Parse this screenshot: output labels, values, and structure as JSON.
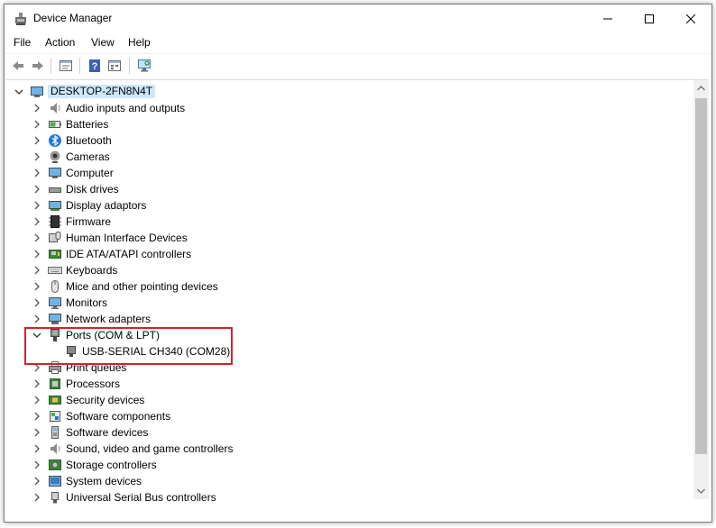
{
  "window": {
    "title": "Device Manager",
    "menu": [
      "File",
      "Action",
      "View",
      "Help"
    ]
  },
  "toolbar": {
    "buttons": [
      "back-icon",
      "forward-icon",
      "properties-icon",
      "help-icon",
      "show-hidden-icon",
      "scan-hardware-icon"
    ]
  },
  "tree": {
    "root": "DESKTOP-2FN8N4T",
    "categories": [
      {
        "label": "Audio inputs and outputs",
        "icon": "speaker-icon",
        "expanded": false
      },
      {
        "label": "Batteries",
        "icon": "battery-icon",
        "expanded": false
      },
      {
        "label": "Bluetooth",
        "icon": "bluetooth-icon",
        "expanded": false
      },
      {
        "label": "Cameras",
        "icon": "camera-icon",
        "expanded": false
      },
      {
        "label": "Computer",
        "icon": "computer-icon",
        "expanded": false
      },
      {
        "label": "Disk drives",
        "icon": "disk-drive-icon",
        "expanded": false
      },
      {
        "label": "Display adaptors",
        "icon": "display-adapter-icon",
        "expanded": false
      },
      {
        "label": "Firmware",
        "icon": "firmware-icon",
        "expanded": false
      },
      {
        "label": "Human Interface Devices",
        "icon": "hid-icon",
        "expanded": false
      },
      {
        "label": "IDE ATA/ATAPI controllers",
        "icon": "ide-controller-icon",
        "expanded": false
      },
      {
        "label": "Keyboards",
        "icon": "keyboard-icon",
        "expanded": false
      },
      {
        "label": "Mice and other pointing devices",
        "icon": "mouse-icon",
        "expanded": false
      },
      {
        "label": "Monitors",
        "icon": "monitor-icon",
        "expanded": false
      },
      {
        "label": "Network adapters",
        "icon": "network-adapter-icon",
        "expanded": false
      },
      {
        "label": "Ports (COM & LPT)",
        "icon": "port-icon",
        "expanded": true,
        "children": [
          "USB-SERIAL CH340 (COM28)"
        ]
      },
      {
        "label": "Print queues",
        "icon": "printer-icon",
        "expanded": false
      },
      {
        "label": "Processors",
        "icon": "processor-icon",
        "expanded": false
      },
      {
        "label": "Security devices",
        "icon": "security-device-icon",
        "expanded": false
      },
      {
        "label": "Software components",
        "icon": "software-component-icon",
        "expanded": false
      },
      {
        "label": "Software devices",
        "icon": "software-device-icon",
        "expanded": false
      },
      {
        "label": "Sound, video and game controllers",
        "icon": "sound-controller-icon",
        "expanded": false
      },
      {
        "label": "Storage controllers",
        "icon": "storage-controller-icon",
        "expanded": false
      },
      {
        "label": "System devices",
        "icon": "system-device-icon",
        "expanded": false
      },
      {
        "label": "Universal Serial Bus controllers",
        "icon": "usb-controller-icon",
        "expanded": false
      }
    ]
  },
  "colors": {
    "selection": "#cce8ff",
    "highlight_border": "#d3232b",
    "scrollbar_track": "#f0f0f0",
    "scrollbar_thumb": "#c1c1c1"
  }
}
